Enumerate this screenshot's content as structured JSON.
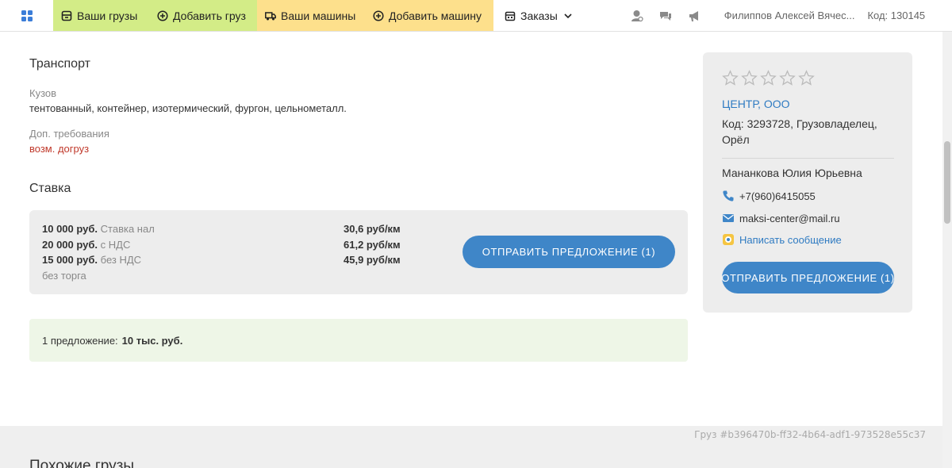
{
  "nav": {
    "apps_icon": "grid-icon",
    "items": [
      {
        "label": "Ваши грузы",
        "icon": "cargo-icon"
      },
      {
        "label": "Добавить груз",
        "icon": "plus-circle-icon"
      },
      {
        "label": "Ваши машины",
        "icon": "truck-icon"
      },
      {
        "label": "Добавить машину",
        "icon": "plus-circle-icon"
      },
      {
        "label": "Заказы",
        "icon": "calendar-icon"
      }
    ],
    "icons": [
      "user-settings-icon",
      "chat-icon",
      "megaphone-icon"
    ],
    "user_name": "Филиппов Алексей Вячес...",
    "user_code": "Код: 130145",
    "colors": {
      "green": "#d3ec87",
      "yellow": "#fde08c"
    }
  },
  "transport": {
    "title": "Транспорт",
    "body_label": "Кузов",
    "body_value": "тентованный, контейнер, изотермический, фургон, цельнометалл.",
    "req_label": "Доп. требования",
    "req_value": "возм. догруз"
  },
  "rate": {
    "title": "Ставка",
    "lines": [
      {
        "amount": "10 000 руб.",
        "note": "Ставка нал",
        "per_km": "30,6 руб/км"
      },
      {
        "amount": "20 000 руб.",
        "note": "с НДС",
        "per_km": "61,2 руб/км"
      },
      {
        "amount": "15 000 руб.",
        "note": "без НДС",
        "per_km": "45,9 руб/км"
      }
    ],
    "no_bargain": "без торга",
    "offer_button": "ОТПРАВИТЬ ПРЕДЛОЖЕНИЕ (1)"
  },
  "proposals": {
    "text": "1 предложение:",
    "value": "10 тыс. руб."
  },
  "contact_card": {
    "rating_stars": 0,
    "rating_max": 5,
    "company": "ЦЕНТР, ООО",
    "info": "Код: 3293728, Грузовладелец, Орёл",
    "person": "Мананкова Юлия Юрьевна",
    "phone": "+7(960)6415055",
    "email": "maksi-center@mail.ru",
    "message_link": "Написать сообщение",
    "offer_button": "ОТПРАВИТЬ ПРЕДЛОЖЕНИЕ (1)"
  },
  "footer": {
    "cargo_id": "Груз #b396470b-ff32-4b64-adf1-973528e55c37",
    "similar_title": "Похожие грузы"
  }
}
